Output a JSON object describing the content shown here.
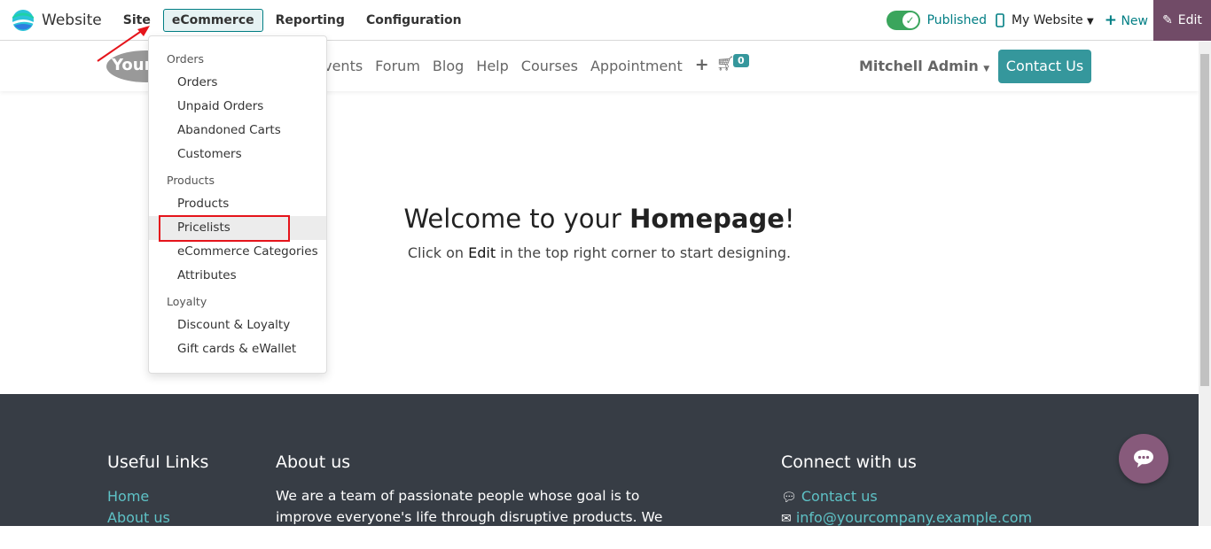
{
  "topbar": {
    "app_name": "Website",
    "menu": [
      "Site",
      "eCommerce",
      "Reporting",
      "Configuration"
    ],
    "published_label": "Published",
    "website_selector": "My Website",
    "new_label": "New",
    "edit_label": "Edit",
    "accent": "#714b67"
  },
  "dropdown": {
    "sections": [
      {
        "header": "Orders",
        "items": [
          "Orders",
          "Unpaid Orders",
          "Abandoned Carts",
          "Customers"
        ]
      },
      {
        "header": "Products",
        "items": [
          "Products",
          "Pricelists",
          "eCommerce Categories",
          "Attributes"
        ]
      },
      {
        "header": "Loyalty",
        "items": [
          "Discount & Loyalty",
          "Gift cards & eWallet"
        ]
      }
    ],
    "highlighted": "Pricelists"
  },
  "site": {
    "logo_text": "Your",
    "nav": [
      "Events",
      "Forum",
      "Blog",
      "Help",
      "Courses",
      "Appointment"
    ],
    "nav_visible": [
      "vents",
      "Forum",
      "Blog",
      "Help",
      "Courses",
      "Appointment"
    ],
    "cart_count": "0",
    "user": "Mitchell Admin",
    "contact_button": "Contact Us"
  },
  "hero": {
    "title_pre": "Welcome to your ",
    "title_bold": "Homepage",
    "title_post": "!",
    "sub_pre": "Click on ",
    "sub_bold": "Edit",
    "sub_post": " in the top right corner to start designing."
  },
  "footer": {
    "useful_links_title": "Useful Links",
    "links": [
      "Home",
      "About us"
    ],
    "about_title": "About us",
    "about_text": "We are a team of passionate people whose goal is to improve everyone's life through disruptive products. We build great",
    "connect_title": "Connect with us",
    "contact_link": "Contact us",
    "email": "info@yourcompany.example.com"
  }
}
